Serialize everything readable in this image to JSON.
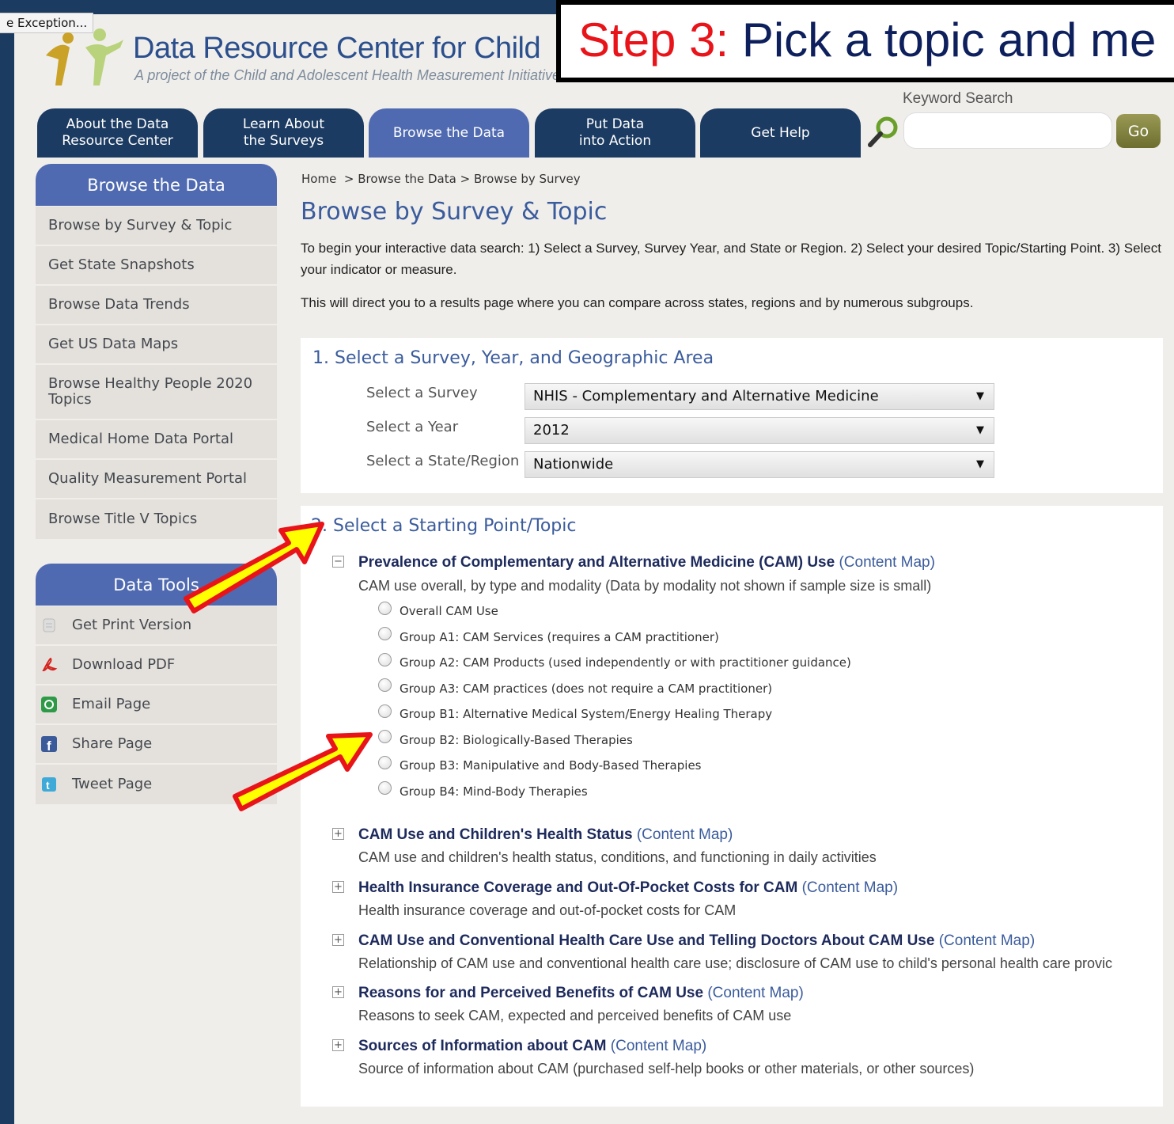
{
  "browser_tab": "e Exception...",
  "header": {
    "title": "Data Resource Center for Child",
    "subtitle": "A project of the Child and Adolescent Health Measurement Initiative"
  },
  "callout": {
    "step": "Step 3:",
    "text": "Pick a topic and me"
  },
  "nav": [
    {
      "line1": "About the Data",
      "line2": "Resource Center"
    },
    {
      "line1": "Learn About",
      "line2": "the Surveys"
    },
    {
      "line1": "Browse the Data",
      "line2": ""
    },
    {
      "line1": "Put Data",
      "line2": "into Action"
    },
    {
      "line1": "Get Help",
      "line2": ""
    }
  ],
  "search": {
    "label": "Keyword Search",
    "value": "",
    "button": "Go"
  },
  "sidebar": {
    "browse_header": "Browse the Data",
    "browse_items": [
      "Browse by Survey & Topic",
      "Get State Snapshots",
      "Browse Data Trends",
      "Get US Data Maps",
      "Browse Healthy People 2020 Topics",
      "Medical Home Data Portal",
      "Quality Measurement Portal",
      "Browse Title V Topics"
    ],
    "tools_header": "Data Tools",
    "tools_items": [
      {
        "label": "Get Print Version",
        "icon": "print-icon"
      },
      {
        "label": "Download PDF",
        "icon": "pdf-icon"
      },
      {
        "label": "Email Page",
        "icon": "email-icon"
      },
      {
        "label": "Share Page",
        "icon": "facebook-icon"
      },
      {
        "label": "Tweet Page",
        "icon": "twitter-icon"
      }
    ]
  },
  "breadcrumb": {
    "home": "Home",
    "sep1": ">",
    "browse": "Browse the Data",
    "sep2": ">",
    "current": "Browse by Survey"
  },
  "main": {
    "title": "Browse by Survey & Topic",
    "intro1": "To begin your interactive data search: 1) Select a Survey, Survey Year, and State or Region. 2) Select your desired Topic/Starting Point. 3) Select your indicator or measure.",
    "intro2": "This will direct you to a results page where you can compare across states, regions and by numerous subgroups.",
    "section1": {
      "title": "1. Select a Survey, Year, and Geographic Area",
      "survey_label": "Select a Survey",
      "survey_value": "NHIS - Complementary and Alternative Medicine",
      "year_label": "Select a Year",
      "year_value": "2012",
      "state_label": "Select a State/Region",
      "state_value": "Nationwide"
    },
    "section2": {
      "title": "2. Select a Starting Point/Topic",
      "content_map": "(Content Map)",
      "topics": [
        {
          "toggle": "−",
          "title": "Prevalence of Complementary and Alternative Medicine (CAM) Use",
          "desc": "CAM use overall, by type and modality (Data by modality not shown if sample size is small)"
        },
        {
          "toggle": "+",
          "title": "CAM Use and Children's Health Status",
          "desc": "CAM use and children's health status, conditions, and functioning in daily activities"
        },
        {
          "toggle": "+",
          "title": "Health Insurance Coverage and Out-Of-Pocket Costs for CAM",
          "desc": "Health insurance coverage and out-of-pocket costs for CAM"
        },
        {
          "toggle": "+",
          "title": "CAM Use and Conventional Health Care Use and Telling Doctors About CAM Use",
          "desc": "Relationship of CAM use and conventional health care use; disclosure of CAM use to child's personal health care provic"
        },
        {
          "toggle": "+",
          "title": "Reasons for and Perceived Benefits of CAM Use",
          "desc": "Reasons to seek CAM, expected and perceived benefits of CAM use"
        },
        {
          "toggle": "+",
          "title": "Sources of Information about CAM",
          "desc": "Source of information about CAM (purchased self-help books or other materials, or other sources)"
        }
      ],
      "options": [
        "Overall CAM Use",
        "Group A1: CAM Services (requires a CAM practitioner)",
        "Group A2: CAM Products (used independently or with practitioner guidance)",
        "Group A3: CAM practices (does not require a CAM practitioner)",
        "Group B1: Alternative Medical System/Energy Healing Therapy",
        "Group B2: Biologically-Based Therapies",
        "Group B3: Manipulative and Body-Based Therapies",
        "Group B4: Mind-Body Therapies"
      ]
    }
  },
  "colors": {
    "frame": "#1c3b60",
    "nav": "#1c3b62",
    "nav_active": "#4f6ab0",
    "arrow_fill": "#ffff00",
    "arrow_stroke": "#e8141a",
    "callout_red": "#e8141a"
  }
}
